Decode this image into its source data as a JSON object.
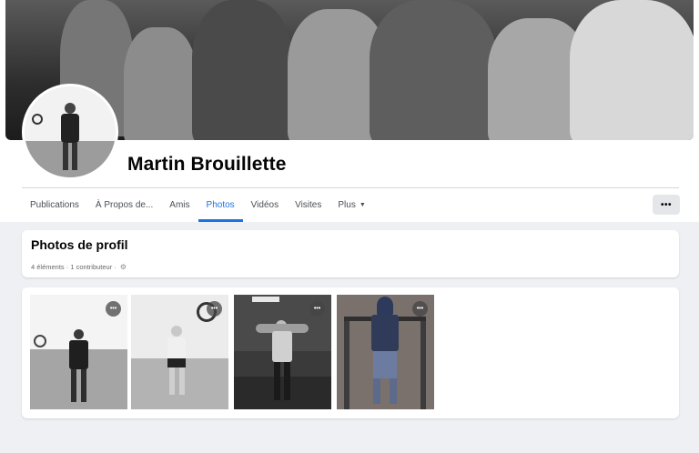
{
  "profile": {
    "name": "Martin Brouillette"
  },
  "tabs": [
    {
      "label": "Publications"
    },
    {
      "label": "À Propos de..."
    },
    {
      "label": "Amis"
    },
    {
      "label": "Photos",
      "active": true
    },
    {
      "label": "Vidéos"
    },
    {
      "label": "Visites"
    },
    {
      "label": "Plus"
    }
  ],
  "more_button": {
    "label": "•••"
  },
  "section": {
    "title": "Photos de profil",
    "meta": "4 éléments · 1 contributeur ·"
  },
  "photos": [
    {
      "menu": "•••"
    },
    {
      "menu": "•••"
    },
    {
      "menu": "•••"
    },
    {
      "menu": "•••"
    }
  ],
  "icons": {
    "tab_more": "caret-down-icon",
    "section_meta": "gear-icon",
    "photo_menu": "more-options-icon"
  },
  "colors": {
    "accent": "#1b74e4",
    "page_background": "#eef0f3",
    "card_background": "#ffffff"
  }
}
